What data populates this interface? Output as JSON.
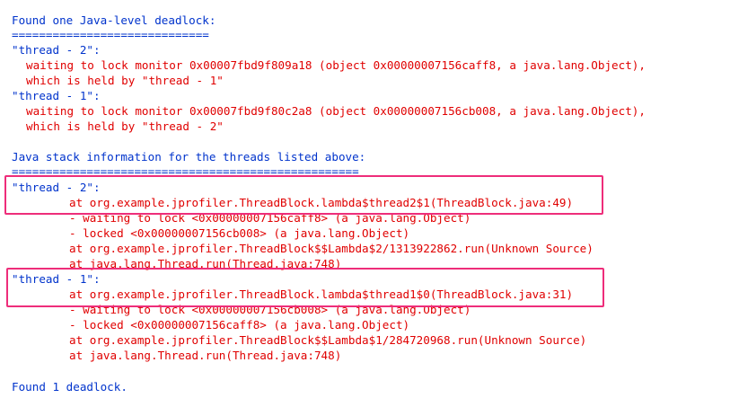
{
  "console": {
    "found_header": "Found one Java-level deadlock:",
    "sep1": "=============================",
    "t2_name": "\"thread - 2\":",
    "t2_wait1": "waiting to lock monitor 0x00007fbd9f809a18 (object 0x00000007156caff8, a java.lang.Object),",
    "t2_wait2": "which is held by \"thread - 1\"",
    "t1_name": "\"thread - 1\":",
    "t1_wait1": "waiting to lock monitor 0x00007fbd9f80c2a8 (object 0x00000007156cb008, a java.lang.Object),",
    "t1_wait2": "which is held by \"thread - 2\"",
    "stack_header": "Java stack information for the threads listed above:",
    "sep2": "===================================================",
    "s2_name": "\"thread - 2\":",
    "s2_l1": "at org.example.jprofiler.ThreadBlock.lambda$thread2$1(ThreadBlock.java:49)",
    "s2_l2": "- waiting to lock <0x00000007156caff8> (a java.lang.Object)",
    "s2_l3": "- locked <0x00000007156cb008> (a java.lang.Object)",
    "s2_l4": "at org.example.jprofiler.ThreadBlock$$Lambda$2/1313922862.run(Unknown Source)",
    "s2_l5": "at java.lang.Thread.run(Thread.java:748)",
    "s1_name": "\"thread - 1\":",
    "s1_l1": "at org.example.jprofiler.ThreadBlock.lambda$thread1$0(ThreadBlock.java:31)",
    "s1_l2": "- waiting to lock <0x00000007156cb008> (a java.lang.Object)",
    "s1_l3": "- locked <0x00000007156caff8> (a java.lang.Object)",
    "s1_l4": "at org.example.jprofiler.ThreadBlock$$Lambda$1/284720968.run(Unknown Source)",
    "s1_l5": "at java.lang.Thread.run(Thread.java:748)",
    "footer": "Found 1 deadlock."
  },
  "colors": {
    "header_text": "#0033cc",
    "detail_text": "#e00000",
    "highlight_box": "#ee2d7a",
    "background": "#ffffff"
  }
}
